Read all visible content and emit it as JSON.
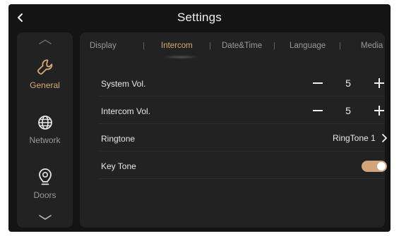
{
  "header": {
    "title": "Settings",
    "back_icon": "chevron-left-icon"
  },
  "sidebar": {
    "items": [
      {
        "label": "General",
        "icon": "wrench-icon",
        "active": true
      },
      {
        "label": "Network",
        "icon": "globe-icon",
        "active": false
      },
      {
        "label": "Doors",
        "icon": "doorbell-camera-icon",
        "active": false
      }
    ],
    "scroll_up_icon": "chevron-up-icon",
    "scroll_down_icon": "chevron-down-icon"
  },
  "tabs": [
    {
      "label": "Display",
      "active": false
    },
    {
      "label": "Intercom",
      "active": true
    },
    {
      "label": "Date&Time",
      "active": false
    },
    {
      "label": "Language",
      "active": false
    },
    {
      "label": "Media",
      "active": false
    }
  ],
  "tab_separator": "|",
  "settings": {
    "system_vol": {
      "label": "System Vol.",
      "value": "5"
    },
    "intercom_vol": {
      "label": "Intercom Vol.",
      "value": "5"
    },
    "ringtone": {
      "label": "Ringtone",
      "value": "RingTone 1"
    },
    "key_tone": {
      "label": "Key Tone",
      "enabled": true
    }
  },
  "colors": {
    "accent": "#d8a877",
    "toggle_on": "#d3a47a",
    "background": "#141414",
    "panel": "#222222"
  }
}
